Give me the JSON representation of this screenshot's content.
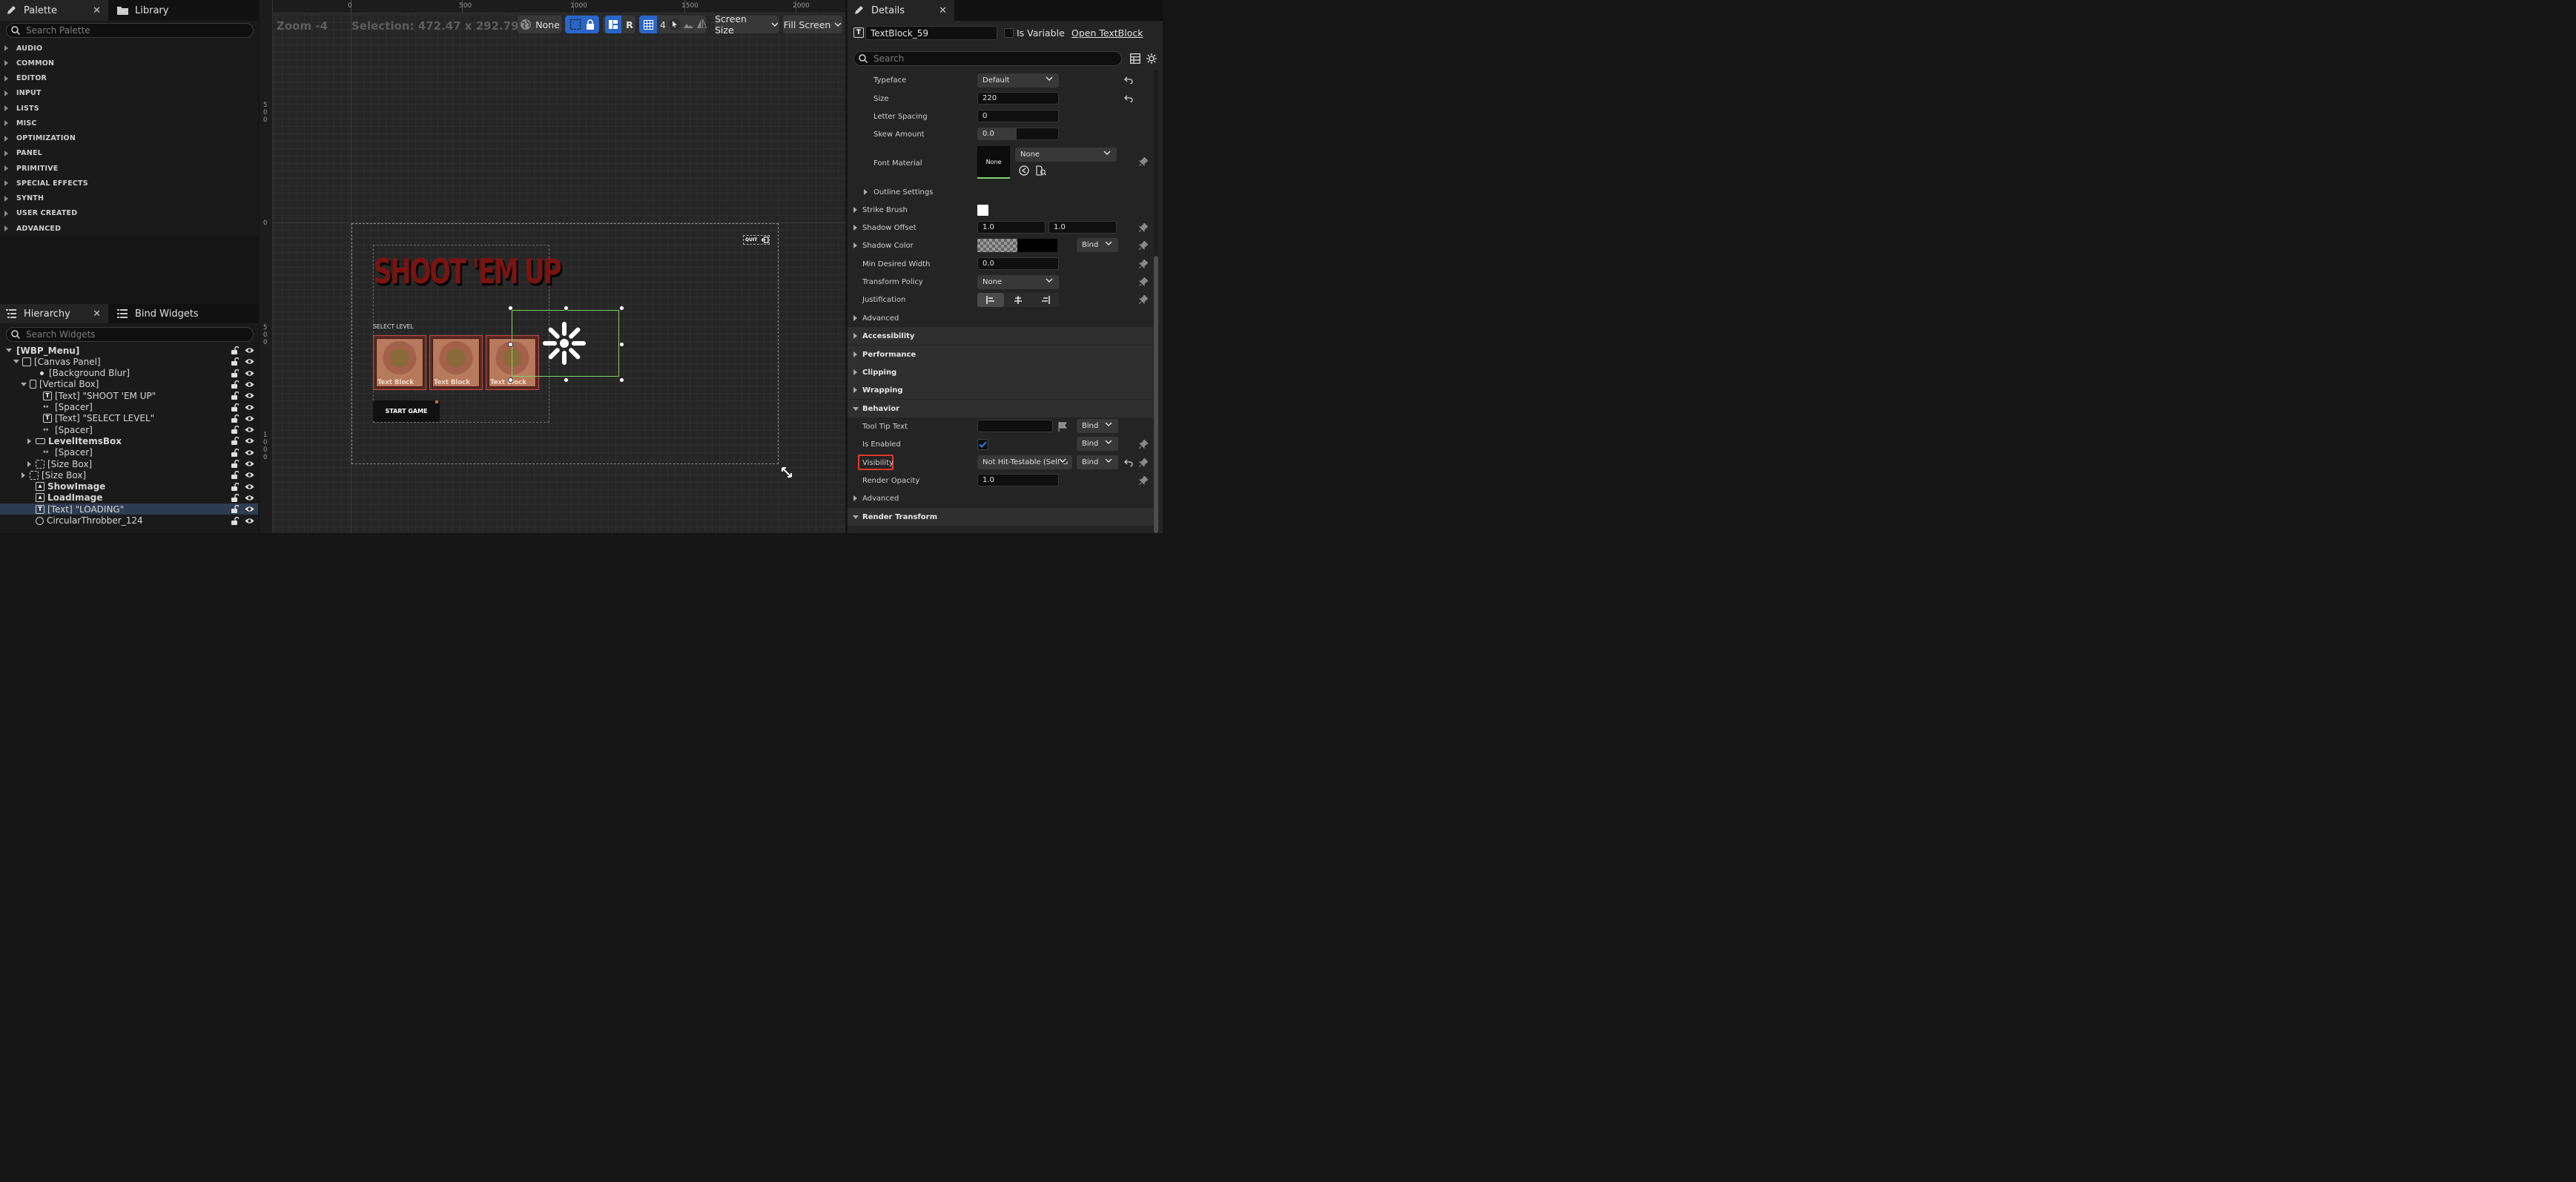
{
  "palette": {
    "tab_label": "Palette",
    "library_tab_label": "Library",
    "search_placeholder": "Search Palette",
    "categories": [
      "AUDIO",
      "COMMON",
      "EDITOR",
      "INPUT",
      "LISTS",
      "MISC",
      "OPTIMIZATION",
      "PANEL",
      "PRIMITIVE",
      "SPECIAL EFFECTS",
      "SYNTH",
      "USER CREATED",
      "ADVANCED"
    ]
  },
  "hierarchy": {
    "tab_label": "Hierarchy",
    "bind_tab_label": "Bind Widgets",
    "search_placeholder": "Search Widgets",
    "rows": [
      {
        "label": "[WBP_Menu]",
        "bold": true
      },
      {
        "label": "[Canvas Panel]"
      },
      {
        "label": "[Background Blur]"
      },
      {
        "label": "[Vertical Box]"
      },
      {
        "label": "[Text] \"SHOOT 'EM UP\""
      },
      {
        "label": "[Spacer]"
      },
      {
        "label": "[Text] \"SELECT LEVEL\""
      },
      {
        "label": "[Spacer]"
      },
      {
        "label": "LevelItemsBox",
        "bold": true
      },
      {
        "label": "[Spacer]"
      },
      {
        "label": "[Size Box]"
      },
      {
        "label": "[Size Box]"
      },
      {
        "label": "ShowImage",
        "bold": true
      },
      {
        "label": "LoadImage",
        "bold": true
      },
      {
        "label": "[Text] \"LOADING\"",
        "selected": true
      },
      {
        "label": "CircularThrobber_124"
      }
    ]
  },
  "designer": {
    "zoom_label": "Zoom -4",
    "selection_label": "Selection: 472.47 x 292.79",
    "toolbar": {
      "none_label": "None",
      "r_label": "R",
      "grid_value": "4",
      "screen_size_label": "Screen Size",
      "fill_screen_label": "Fill Screen"
    },
    "ruler_top": [
      "0",
      "500",
      "1000",
      "1500",
      "2000"
    ],
    "ruler_left": [
      "5\n0\n0",
      "0",
      "5\n0\n0",
      "1\n0\n0\n0"
    ],
    "widget": {
      "title": "SHOOT 'EM UP",
      "select_level": "SELECT LEVEL",
      "level_items": [
        "Text Block",
        "Text Block",
        "Text Block"
      ],
      "start_button": "START GAME",
      "quit_button": "QUIT"
    }
  },
  "details": {
    "tab_label": "Details",
    "widget_name": "TextBlock_59",
    "is_variable_label": "Is Variable",
    "open_link": "Open TextBlock",
    "search_placeholder": "Search",
    "rows": {
      "typeface": {
        "label": "Typeface",
        "value": "Default"
      },
      "size": {
        "label": "Size",
        "value": "220"
      },
      "letter_spacing": {
        "label": "Letter Spacing",
        "value": "0"
      },
      "skew_amount": {
        "label": "Skew Amount",
        "value": "0.0"
      },
      "font_material": {
        "label": "Font Material",
        "thumb": "None",
        "value": "None"
      },
      "outline_settings": {
        "label": "Outline Settings"
      },
      "strike_brush": {
        "label": "Strike Brush"
      },
      "shadow_offset": {
        "label": "Shadow Offset",
        "x": "1.0",
        "y": "1.0"
      },
      "shadow_color": {
        "label": "Shadow Color",
        "bind": "Bind"
      },
      "min_desired_width": {
        "label": "Min Desired Width",
        "value": "0.0"
      },
      "transform_policy": {
        "label": "Transform Policy",
        "value": "None"
      },
      "justification": {
        "label": "Justification"
      },
      "tool_tip_text": {
        "label": "Tool Tip Text",
        "bind": "Bind"
      },
      "is_enabled": {
        "label": "Is Enabled",
        "bind": "Bind"
      },
      "visibility": {
        "label": "Visibility",
        "value": "Not Hit-Testable (Self &",
        "bind": "Bind"
      },
      "render_opacity": {
        "label": "Render Opacity",
        "value": "1.0"
      }
    },
    "sections": {
      "advanced_1": "Advanced",
      "accessibility": "Accessibility",
      "performance": "Performance",
      "clipping": "Clipping",
      "wrapping": "Wrapping",
      "behavior": "Behavior",
      "advanced_2": "Advanced",
      "render_transform": "Render Transform"
    }
  },
  "colors": {
    "accent_blue": "#2a66c9",
    "selection_green": "#7ed36a",
    "title_red": "#7a1411",
    "highlight_red": "#e0392b"
  }
}
